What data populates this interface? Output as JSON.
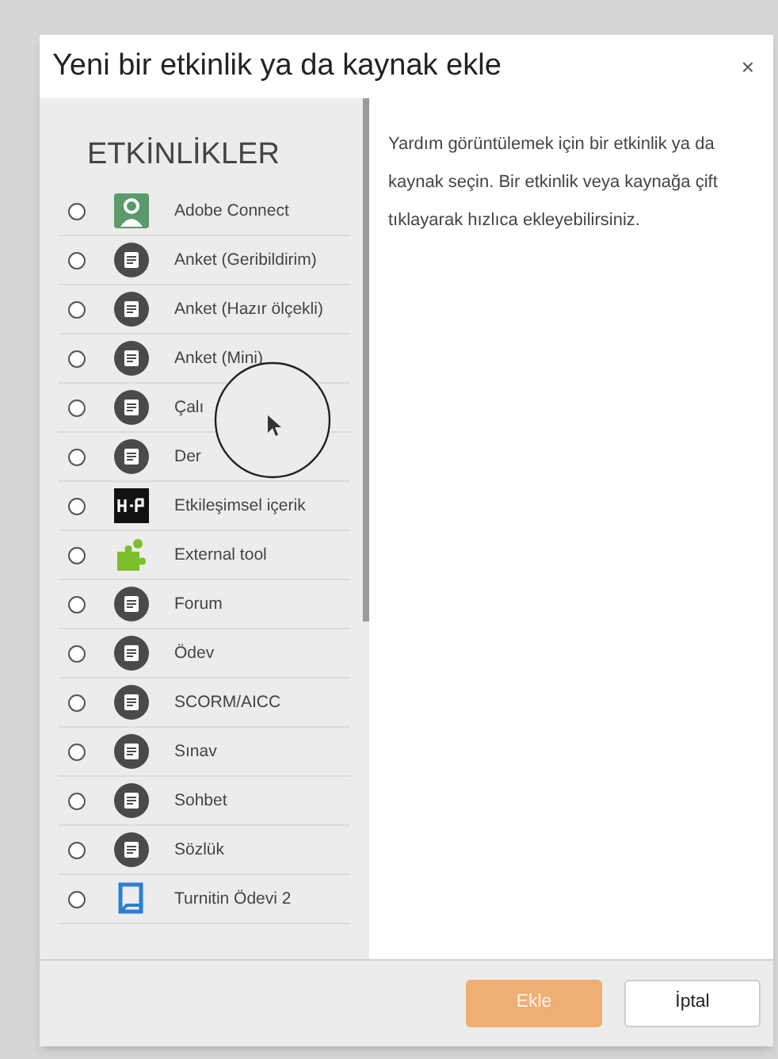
{
  "dialog": {
    "title": "Yeni bir etkinlik ya da kaynak ekle",
    "close": "×"
  },
  "list": {
    "heading": "ETKİNLİKLER",
    "items": [
      {
        "label": "Adobe Connect",
        "kind": "tile",
        "selected": false
      },
      {
        "label": "Anket (Geribildirim)",
        "kind": "round",
        "selected": false
      },
      {
        "label": "Anket (Hazır ölçekli)",
        "kind": "round",
        "selected": false
      },
      {
        "label": "Anket (Mini)",
        "kind": "round",
        "selected": false
      },
      {
        "label": "Çalı",
        "kind": "round",
        "selected": false
      },
      {
        "label": "Der",
        "kind": "round",
        "selected": false
      },
      {
        "label": "Etkileşimsel içerik",
        "kind": "badge",
        "selected": false
      },
      {
        "label": "External tool",
        "kind": "puzzle",
        "selected": false
      },
      {
        "label": "Forum",
        "kind": "round",
        "selected": false
      },
      {
        "label": "Ödev",
        "kind": "round",
        "selected": false
      },
      {
        "label": "SCORM/AICC",
        "kind": "round",
        "selected": false
      },
      {
        "label": "Sınav",
        "kind": "round",
        "selected": false
      },
      {
        "label": "Sohbet",
        "kind": "round",
        "selected": false
      },
      {
        "label": "Sözlük",
        "kind": "round",
        "selected": false
      },
      {
        "label": "Turnitin Ödevi 2",
        "kind": "bookmark",
        "selected": false
      }
    ]
  },
  "help": "Yardım görüntülemek için bir etkinlik ya da kaynak seçin. Bir etkinlik veya kaynağa çift tıklayarak hızlıca ekleyebilirsiniz.",
  "buttons": [
    {
      "label": "Ekle",
      "kind": "primary",
      "disabled": true
    },
    {
      "label": "İptal",
      "kind": "secondary",
      "disabled": false
    }
  ]
}
